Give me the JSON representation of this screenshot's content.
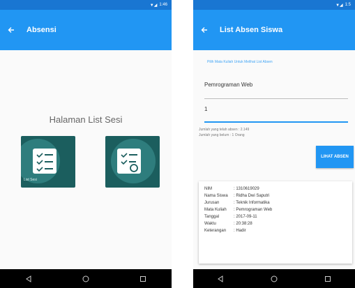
{
  "screen1": {
    "status_time": "1:46",
    "title": "Absensi",
    "heading": "Halaman List Sesi",
    "tiles": [
      {
        "label": "List Sesi",
        "icon": "checklist-icon"
      },
      {
        "label": "",
        "icon": "checklist-search-icon"
      }
    ]
  },
  "screen2": {
    "status_time": "1:5",
    "title": "List Absen Siswa",
    "hint": "Pilih Mata Kuliah Untuk Melihat List Absen",
    "course_value": "Pemrograman Web",
    "session_value": "1",
    "count_present": "Jumlah yang telah absen : 2.149",
    "count_absent": "Jumlah yang belum : 1 Orang",
    "button_label": "LIHAT ABSEN",
    "record": [
      {
        "key": "NIM",
        "value": ": 1310619029"
      },
      {
        "key": "Nama Siswa",
        "value": ": Ridha Dwi Saputri"
      },
      {
        "key": "Jurusan",
        "value": ": Teknik Informatika"
      },
      {
        "key": "Mata Kuliah",
        "value": ": Pemrograman Web"
      },
      {
        "key": "Tanggal",
        "value": ": 2017-09-11"
      },
      {
        "key": "Waktu",
        "value": ": 20:38:28"
      },
      {
        "key": "Keterangan",
        "value": ": Hadir"
      }
    ]
  },
  "colors": {
    "primary": "#2196f3",
    "primary_dark": "#1976d2",
    "tile_bg": "#1b5e5e"
  }
}
